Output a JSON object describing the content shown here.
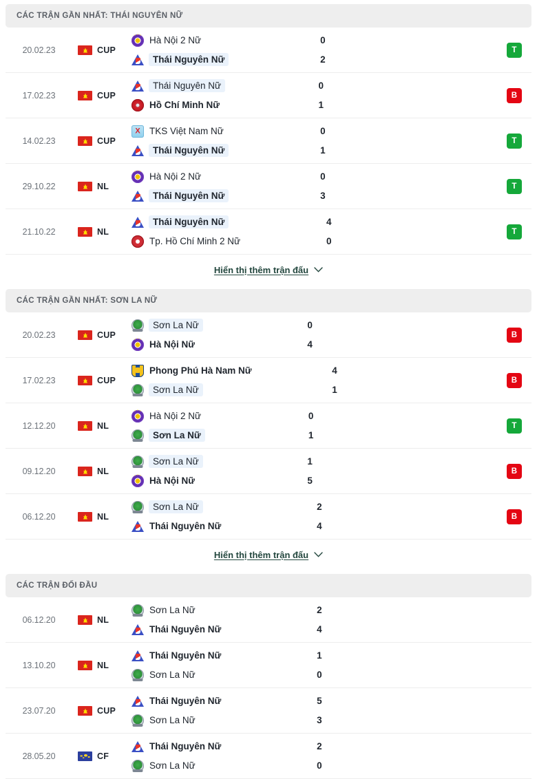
{
  "sections": [
    {
      "id": "recent-thai-nguyen",
      "title": "CÁC TRẬN GẦN NHẤT: THÁI NGUYÊN NỮ",
      "show_more_label": "Hiển thị thêm trận đấu",
      "has_show_more": true,
      "matches": [
        {
          "date": "20.02.23",
          "flag": "vn",
          "competition": "CUP",
          "home": {
            "name": "Hà Nội 2 Nữ",
            "logo": "hanoi",
            "bold": false,
            "highlight": false
          },
          "away": {
            "name": "Thái Nguyên Nữ",
            "logo": "thainguyen",
            "bold": true,
            "highlight": true
          },
          "home_score": "0",
          "away_score": "2",
          "result": "T",
          "result_type": "W"
        },
        {
          "date": "17.02.23",
          "flag": "vn",
          "competition": "CUP",
          "home": {
            "name": "Thái Nguyên Nữ",
            "logo": "thainguyen",
            "bold": false,
            "highlight": true
          },
          "away": {
            "name": "Hồ Chí Minh Nữ",
            "logo": "hcm",
            "bold": true,
            "highlight": false
          },
          "home_score": "0",
          "away_score": "1",
          "result": "B",
          "result_type": "L"
        },
        {
          "date": "14.02.23",
          "flag": "vn",
          "competition": "CUP",
          "home": {
            "name": "TKS Việt Nam Nữ",
            "logo": "tks",
            "bold": false,
            "highlight": false
          },
          "away": {
            "name": "Thái Nguyên Nữ",
            "logo": "thainguyen",
            "bold": true,
            "highlight": true
          },
          "home_score": "0",
          "away_score": "1",
          "result": "T",
          "result_type": "W"
        },
        {
          "date": "29.10.22",
          "flag": "vn",
          "competition": "NL",
          "home": {
            "name": "Hà Nội 2 Nữ",
            "logo": "hanoi",
            "bold": false,
            "highlight": false
          },
          "away": {
            "name": "Thái Nguyên Nữ",
            "logo": "thainguyen",
            "bold": true,
            "highlight": true
          },
          "home_score": "0",
          "away_score": "3",
          "result": "T",
          "result_type": "W"
        },
        {
          "date": "21.10.22",
          "flag": "vn",
          "competition": "NL",
          "home": {
            "name": "Thái Nguyên Nữ",
            "logo": "thainguyen",
            "bold": true,
            "highlight": true
          },
          "away": {
            "name": "Tp. Hồ Chí Minh 2 Nữ",
            "logo": "hcm2",
            "bold": false,
            "highlight": false
          },
          "home_score": "4",
          "away_score": "0",
          "result": "T",
          "result_type": "W"
        }
      ]
    },
    {
      "id": "recent-son-la",
      "title": "CÁC TRẬN GẦN NHẤT: SƠN LA NỮ",
      "show_more_label": "Hiển thị thêm trận đấu",
      "has_show_more": true,
      "matches": [
        {
          "date": "20.02.23",
          "flag": "vn",
          "competition": "CUP",
          "home": {
            "name": "Sơn La Nữ",
            "logo": "sonla",
            "bold": false,
            "highlight": true
          },
          "away": {
            "name": "Hà Nội Nữ",
            "logo": "hanoi",
            "bold": true,
            "highlight": false
          },
          "home_score": "0",
          "away_score": "4",
          "result": "B",
          "result_type": "L"
        },
        {
          "date": "17.02.23",
          "flag": "vn",
          "competition": "CUP",
          "home": {
            "name": "Phong Phú Hà Nam Nữ",
            "logo": "phonghpu",
            "bold": true,
            "highlight": false
          },
          "away": {
            "name": "Sơn La Nữ",
            "logo": "sonla",
            "bold": false,
            "highlight": true
          },
          "home_score": "4",
          "away_score": "1",
          "result": "B",
          "result_type": "L"
        },
        {
          "date": "12.12.20",
          "flag": "vn",
          "competition": "NL",
          "home": {
            "name": "Hà Nội 2 Nữ",
            "logo": "hanoi",
            "bold": false,
            "highlight": false
          },
          "away": {
            "name": "Sơn La Nữ",
            "logo": "sonla",
            "bold": true,
            "highlight": true
          },
          "home_score": "0",
          "away_score": "1",
          "result": "T",
          "result_type": "W"
        },
        {
          "date": "09.12.20",
          "flag": "vn",
          "competition": "NL",
          "home": {
            "name": "Sơn La Nữ",
            "logo": "sonla",
            "bold": false,
            "highlight": true
          },
          "away": {
            "name": "Hà Nội Nữ",
            "logo": "hanoi",
            "bold": true,
            "highlight": false
          },
          "home_score": "1",
          "away_score": "5",
          "result": "B",
          "result_type": "L"
        },
        {
          "date": "06.12.20",
          "flag": "vn",
          "competition": "NL",
          "home": {
            "name": "Sơn La Nữ",
            "logo": "sonla",
            "bold": false,
            "highlight": true
          },
          "away": {
            "name": "Thái Nguyên Nữ",
            "logo": "thainguyen",
            "bold": true,
            "highlight": false
          },
          "home_score": "2",
          "away_score": "4",
          "result": "B",
          "result_type": "L"
        }
      ]
    },
    {
      "id": "head-to-head",
      "title": "CÁC TRẬN ĐỐI ĐẦU",
      "show_more_label": "",
      "has_show_more": false,
      "matches": [
        {
          "date": "06.12.20",
          "flag": "vn",
          "competition": "NL",
          "home": {
            "name": "Sơn La Nữ",
            "logo": "sonla",
            "bold": false,
            "highlight": false
          },
          "away": {
            "name": "Thái Nguyên Nữ",
            "logo": "thainguyen",
            "bold": true,
            "highlight": false
          },
          "home_score": "2",
          "away_score": "4",
          "result": "",
          "result_type": "none"
        },
        {
          "date": "13.10.20",
          "flag": "vn",
          "competition": "NL",
          "home": {
            "name": "Thái Nguyên Nữ",
            "logo": "thainguyen",
            "bold": true,
            "highlight": false
          },
          "away": {
            "name": "Sơn La Nữ",
            "logo": "sonla",
            "bold": false,
            "highlight": false
          },
          "home_score": "1",
          "away_score": "0",
          "result": "",
          "result_type": "none"
        },
        {
          "date": "23.07.20",
          "flag": "vn",
          "competition": "CUP",
          "home": {
            "name": "Thái Nguyên Nữ",
            "logo": "thainguyen",
            "bold": true,
            "highlight": false
          },
          "away": {
            "name": "Sơn La Nữ",
            "logo": "sonla",
            "bold": false,
            "highlight": false
          },
          "home_score": "5",
          "away_score": "3",
          "result": "",
          "result_type": "none"
        },
        {
          "date": "28.05.20",
          "flag": "int",
          "competition": "CF",
          "home": {
            "name": "Thái Nguyên Nữ",
            "logo": "thainguyen",
            "bold": true,
            "highlight": false
          },
          "away": {
            "name": "Sơn La Nữ",
            "logo": "sonla",
            "bold": false,
            "highlight": false
          },
          "home_score": "2",
          "away_score": "0",
          "result": "",
          "result_type": "none"
        }
      ]
    }
  ],
  "colors": {
    "win": "#15a83a",
    "loss": "#e40613",
    "highlight_bg": "#eaf2fb",
    "header_bg": "#eeeeee",
    "link": "#23473e"
  }
}
